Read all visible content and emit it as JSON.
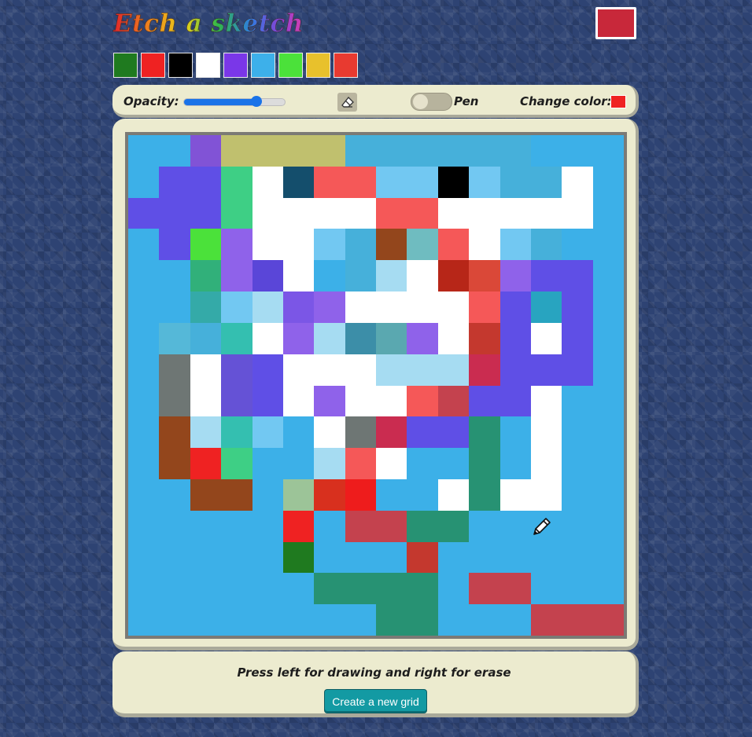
{
  "app": {
    "title": "Etch a sketch",
    "current_color": "#c8283a"
  },
  "palette": {
    "colors": [
      "#1f7a1f",
      "#ef2222",
      "#000000",
      "#ffffff",
      "#7a37e8",
      "#3db0ea",
      "#4be13a",
      "#e8c12c",
      "#e83a30"
    ]
  },
  "toolbar": {
    "opacity_label": "Opacity:",
    "opacity_value": 0.72,
    "eraser_icon": "eraser-icon",
    "pen_label": "Pen",
    "change_color_label": "Change color:",
    "change_color_value": "#ef2222"
  },
  "grid": {
    "size": 16,
    "cells": [
      [
        "#3cb0e8",
        "#3cb0e8",
        "#8153d6",
        "#c0c06e",
        "#c0c06e",
        "#c0c06e",
        "#c0c06e",
        "#46b0da",
        "#46b0da",
        "#46b0da",
        "#46b0da",
        "#46b0da",
        "#46b0da",
        "#3cb0e8",
        "#3cb0e8",
        "#3cb0e8"
      ],
      [
        "#3cb0e8",
        "#5f4fe6",
        "#5f4fe6",
        "#3ecf85",
        "#ffffff",
        "#144e6c",
        "#f55858",
        "#f55858",
        "#72c8f2",
        "#72c8f2",
        "#000000",
        "#72c8f2",
        "#46b0da",
        "#46b0da",
        "#ffffff",
        "#3cb0e8"
      ],
      [
        "#5f4fe6",
        "#5f4fe6",
        "#5f4fe6",
        "#3ecf85",
        "#ffffff",
        "#ffffff",
        "#ffffff",
        "#ffffff",
        "#f55858",
        "#f55858",
        "#ffffff",
        "#ffffff",
        "#ffffff",
        "#ffffff",
        "#ffffff",
        "#3cb0e8"
      ],
      [
        "#3cb0e8",
        "#5f4fe6",
        "#4be13a",
        "#8f62ea",
        "#ffffff",
        "#ffffff",
        "#72c8f2",
        "#46b0da",
        "#93461c",
        "#6fbcc0",
        "#f55858",
        "#ffffff",
        "#72c8f2",
        "#46b0da",
        "#3cb0e8",
        "#3cb0e8"
      ],
      [
        "#3cb0e8",
        "#3cb0e8",
        "#31b07a",
        "#8f62ea",
        "#5a46d8",
        "#ffffff",
        "#3cb0e8",
        "#46b0da",
        "#a6dcf2",
        "#ffffff",
        "#b72618",
        "#da4838",
        "#8f62ea",
        "#5f4fe6",
        "#5f4fe6",
        "#3cb0e8"
      ],
      [
        "#3cb0e8",
        "#3cb0e8",
        "#34aaa8",
        "#72c8f2",
        "#a6dcf2",
        "#7b56e6",
        "#8f62ea",
        "#ffffff",
        "#ffffff",
        "#ffffff",
        "#ffffff",
        "#f55858",
        "#5f4fe6",
        "#28a4c0",
        "#5f4fe6",
        "#3cb0e8"
      ],
      [
        "#3cb0e8",
        "#55b8d8",
        "#46b0da",
        "#34bfb0",
        "#ffffff",
        "#8f62ea",
        "#a6dcf2",
        "#3c8ea8",
        "#5aa8b0",
        "#8f62ea",
        "#ffffff",
        "#c4382e",
        "#5f4fe6",
        "#ffffff",
        "#5f4fe6",
        "#3cb0e8"
      ],
      [
        "#3cb0e8",
        "#6e7674",
        "#ffffff",
        "#6552d6",
        "#5f4fe6",
        "#ffffff",
        "#ffffff",
        "#ffffff",
        "#a6dcf2",
        "#a6dcf2",
        "#a6dcf2",
        "#ca2c50",
        "#5f4fe6",
        "#5f4fe6",
        "#5f4fe6",
        "#3cb0e8"
      ],
      [
        "#3cb0e8",
        "#6e7674",
        "#ffffff",
        "#6552d6",
        "#5f4fe6",
        "#ffffff",
        "#8f62ea",
        "#ffffff",
        "#ffffff",
        "#f55858",
        "#c4424e",
        "#5f4fe6",
        "#5f4fe6",
        "#ffffff",
        "#3cb0e8",
        "#3cb0e8"
      ],
      [
        "#3cb0e8",
        "#93461c",
        "#a6dcf2",
        "#34bfb0",
        "#72c8f2",
        "#3cb0e8",
        "#ffffff",
        "#6e7674",
        "#ca2c50",
        "#5f4fe6",
        "#5f4fe6",
        "#279273",
        "#3cb0e8",
        "#ffffff",
        "#3cb0e8",
        "#3cb0e8"
      ],
      [
        "#3cb0e8",
        "#93461c",
        "#ef2222",
        "#3ecf85",
        "#3cb0e8",
        "#3cb0e8",
        "#a6dcf2",
        "#f55858",
        "#ffffff",
        "#3cb0e8",
        "#3cb0e8",
        "#279273",
        "#3cb0e8",
        "#ffffff",
        "#3cb0e8",
        "#3cb0e8"
      ],
      [
        "#3cb0e8",
        "#3cb0e8",
        "#93461c",
        "#93461c",
        "#3cb0e8",
        "#9cc498",
        "#d8301e",
        "#ee1c1c",
        "#3cb0e8",
        "#3cb0e8",
        "#ffffff",
        "#279273",
        "#ffffff",
        "#ffffff",
        "#3cb0e8",
        "#3cb0e8"
      ],
      [
        "#3cb0e8",
        "#3cb0e8",
        "#3cb0e8",
        "#3cb0e8",
        "#3cb0e8",
        "#ef2222",
        "#3cb0e8",
        "#c4424e",
        "#c4424e",
        "#279273",
        "#279273",
        "#3cb0e8",
        "#3cb0e8",
        "#3cb0e8",
        "#3cb0e8",
        "#3cb0e8"
      ],
      [
        "#3cb0e8",
        "#3cb0e8",
        "#3cb0e8",
        "#3cb0e8",
        "#3cb0e8",
        "#1f7a1f",
        "#3cb0e8",
        "#3cb0e8",
        "#3cb0e8",
        "#c4382e",
        "#3cb0e8",
        "#3cb0e8",
        "#3cb0e8",
        "#3cb0e8",
        "#3cb0e8",
        "#3cb0e8"
      ],
      [
        "#3cb0e8",
        "#3cb0e8",
        "#3cb0e8",
        "#3cb0e8",
        "#3cb0e8",
        "#3cb0e8",
        "#279273",
        "#279273",
        "#279273",
        "#279273",
        "#3cb0e8",
        "#c4424e",
        "#c4424e",
        "#3cb0e8",
        "#3cb0e8",
        "#3cb0e8"
      ],
      [
        "#3cb0e8",
        "#3cb0e8",
        "#3cb0e8",
        "#3cb0e8",
        "#3cb0e8",
        "#3cb0e8",
        "#3cb0e8",
        "#3cb0e8",
        "#279273",
        "#279273",
        "#3cb0e8",
        "#3cb0e8",
        "#3cb0e8",
        "#c4424e",
        "#c4424e",
        "#c4424e"
      ]
    ]
  },
  "footer": {
    "instructions": "Press left for drawing and right for erase",
    "new_grid_label": "Create a new grid"
  },
  "cursor": {
    "icon": "pencil-icon"
  }
}
